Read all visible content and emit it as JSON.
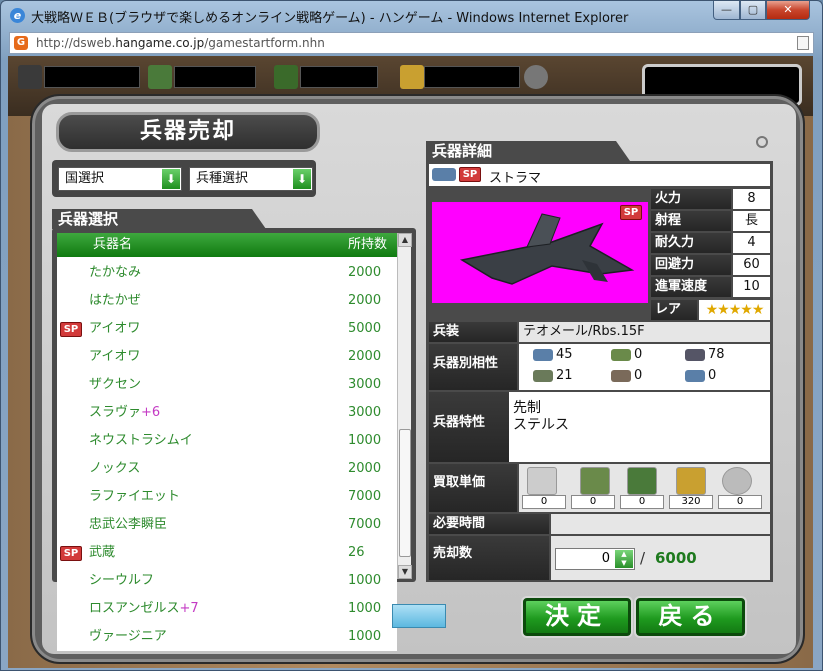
{
  "window": {
    "title": "大戦略ＷＥＢ(ブラウザで楽しめるオンライン戦略ゲーム) - ハンゲーム - Windows Internet Explorer",
    "url_prefix": "http://dsweb.",
    "url_domain": "hangame.co.jp",
    "url_suffix": "/gamestartform.nhn"
  },
  "panel": {
    "title": "兵器売却",
    "country_select": "国選択",
    "type_select": "兵種選択",
    "list_title": "兵器選択",
    "col_name": "兵器名",
    "col_count": "所持数",
    "rows": [
      {
        "name": "たかなみ",
        "count": "2000",
        "sp": false,
        "plus": ""
      },
      {
        "name": "はたかぜ",
        "count": "2000",
        "sp": false,
        "plus": ""
      },
      {
        "name": "アイオワ",
        "count": "5000",
        "sp": true,
        "plus": ""
      },
      {
        "name": "アイオワ",
        "count": "2000",
        "sp": false,
        "plus": ""
      },
      {
        "name": "ザクセン",
        "count": "3000",
        "sp": false,
        "plus": ""
      },
      {
        "name": "スラヴァ",
        "count": "3000",
        "sp": false,
        "plus": "+6"
      },
      {
        "name": "ネウストラシムイ",
        "count": "1000",
        "sp": false,
        "plus": ""
      },
      {
        "name": "ノックス",
        "count": "2000",
        "sp": false,
        "plus": ""
      },
      {
        "name": "ラファイエット",
        "count": "7000",
        "sp": false,
        "plus": ""
      },
      {
        "name": "忠武公李瞬臣",
        "count": "7000",
        "sp": false,
        "plus": ""
      },
      {
        "name": "武蔵",
        "count": "26",
        "sp": true,
        "plus": ""
      },
      {
        "name": "シーウルフ",
        "count": "1000",
        "sp": false,
        "plus": ""
      },
      {
        "name": "ロスアンゼルス",
        "count": "1000",
        "sp": false,
        "plus": "+7"
      },
      {
        "name": "ヴァージニア",
        "count": "1000",
        "sp": false,
        "plus": ""
      }
    ],
    "sp_label": "SP"
  },
  "detail": {
    "title": "兵器詳細",
    "weapon_name": "ストラマ",
    "stats": [
      {
        "label": "火力",
        "value": "8"
      },
      {
        "label": "射程",
        "value": "長"
      },
      {
        "label": "耐久力",
        "value": "4"
      },
      {
        "label": "回避力",
        "value": "60"
      },
      {
        "label": "進軍速度",
        "value": "10"
      }
    ],
    "rare_label": "レア",
    "rare_stars": "★★★★★",
    "armament_label": "兵装",
    "armament_value": "テオメール/Rbs.15F",
    "affinity_label": "兵器別相性",
    "affinity": [
      "45",
      "0",
      "78",
      "21",
      "0",
      "0"
    ],
    "trait_label": "兵器特性",
    "traits": [
      "先制",
      "ステルス"
    ],
    "price_label": "買取単価",
    "prices": [
      "0",
      "0",
      "0",
      "320",
      "0"
    ],
    "time_label": "必要時間",
    "sell_label": "売却数",
    "sell_value": "0",
    "sell_slash": "/",
    "sell_max": "6000"
  },
  "buttons": {
    "confirm": "決定",
    "back": "戻る"
  }
}
